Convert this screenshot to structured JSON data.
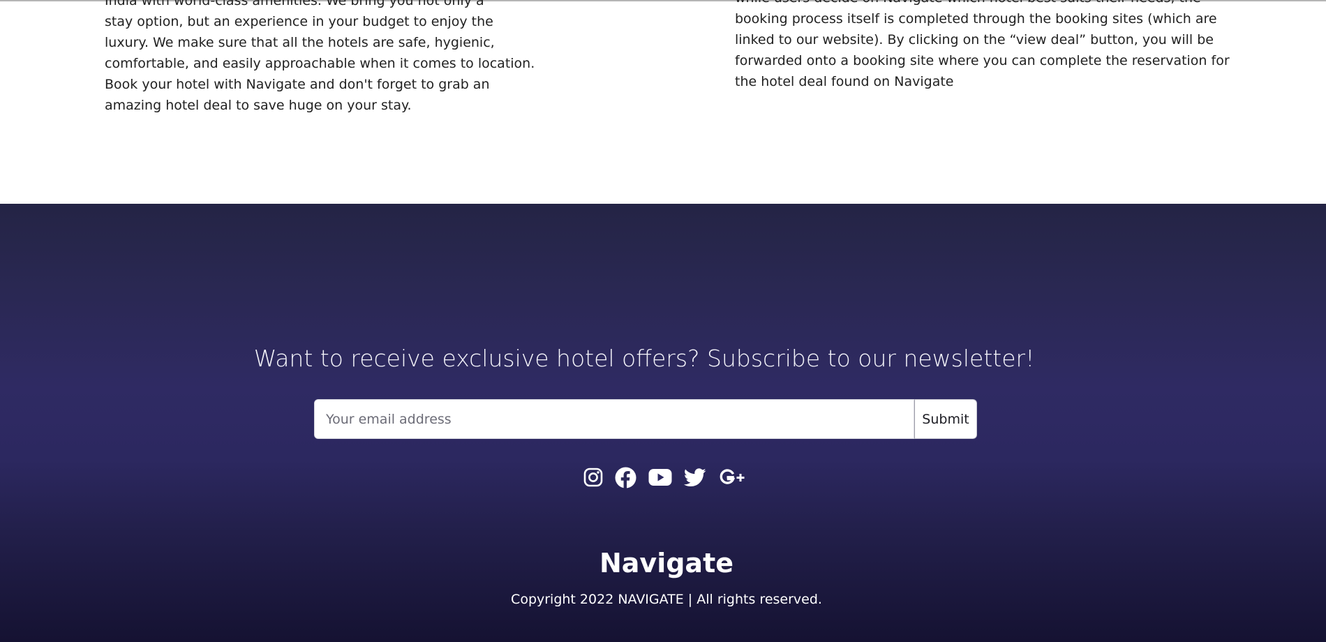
{
  "about_section": {
    "left_paragraph_lines": [
      "India with world-class amenities. We bring you not only a",
      "stay option, but an experience in your budget to enjoy the",
      "luxury. We make sure that all the hotels are safe, hygienic,",
      "comfortable, and easily approachable when it comes to location.",
      "Book your hotel with Navigate and don't forget to grab an",
      "amazing hotel deal to save huge on your stay."
    ],
    "right_paragraph_lines": [
      "while users decide on Navigate which hotel best suits their needs, the",
      "booking process itself is completed through the booking sites (which are",
      "linked to our website). By clicking on the “view deal” button, you will be",
      "forwarded onto a booking site where you can complete the reservation for",
      "the hotel deal found on Navigate"
    ]
  },
  "newsletter": {
    "heading": "Want to receive exclusive hotel offers? Subscribe to our newsletter!",
    "email_placeholder": "Your email address",
    "email_value": "",
    "submit_label": "Submit"
  },
  "social_icons": [
    {
      "icon": "instagram-icon"
    },
    {
      "icon": "facebook-icon"
    },
    {
      "icon": "youtube-icon"
    },
    {
      "icon": "twitter-icon"
    },
    {
      "icon": "google-plus-icon"
    }
  ],
  "footer": {
    "brand": "Navigate",
    "copyright": "Copyright 2022 NAVIGATE | All rights reserved."
  },
  "colors": {
    "footer_top": "#242445",
    "footer_mid": "#2f2a63",
    "footer_bottom": "#151232",
    "footer_text": "#ffffff",
    "body_text": "#222222"
  }
}
